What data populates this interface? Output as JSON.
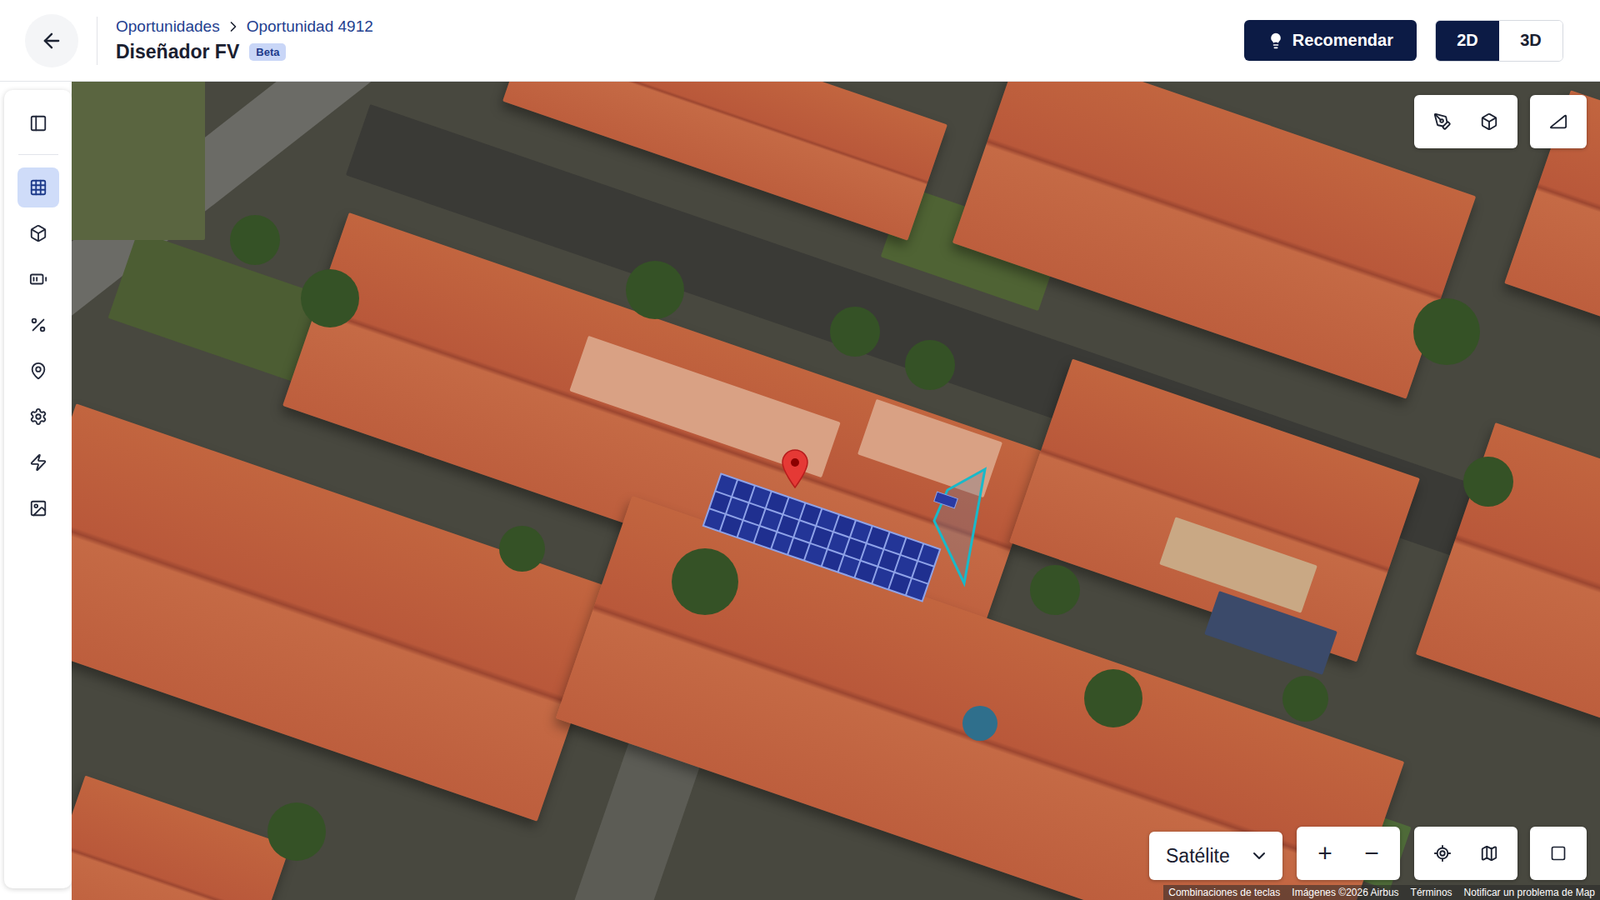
{
  "header": {
    "breadcrumbs": [
      "Oportunidades",
      "Oportunidad 4912"
    ],
    "title": "Diseñador FV",
    "badge": "Beta",
    "recommend_button": "Recomendar",
    "view_toggle": [
      {
        "label": "2D",
        "selected": true
      },
      {
        "label": "3D",
        "selected": false
      }
    ]
  },
  "sidebar": {
    "items": [
      {
        "selected": true
      },
      {
        "selected": false
      },
      {
        "selected": false
      },
      {
        "selected": false
      },
      {
        "selected": false
      },
      {
        "selected": false
      },
      {
        "selected": false
      },
      {
        "selected": false
      }
    ]
  },
  "map": {
    "map_type": "Satélite",
    "zoom_in": "+",
    "zoom_out": "−",
    "attribution": [
      "Combinaciones de teclas",
      "Imágenes ©2026 Airbus",
      "Términos",
      "Notificar un problema de Map"
    ]
  }
}
